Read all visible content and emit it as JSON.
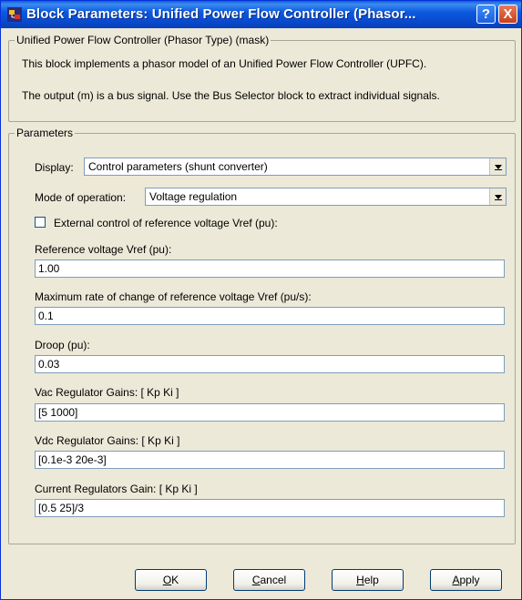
{
  "window": {
    "title": "Block Parameters: Unified Power Flow Controller (Phasor...",
    "help_glyph": "?",
    "close_glyph": "X"
  },
  "mask": {
    "legend": "Unified Power Flow Controller (Phasor Type) (mask)",
    "line1": "This block implements a phasor model of an Unified Power Flow Controller (UPFC).",
    "line2": "The output (m) is a bus signal. Use the Bus Selector block to extract individual signals."
  },
  "params": {
    "legend": "Parameters",
    "display_label": "Display:",
    "display_value": "Control parameters (shunt converter)",
    "mode_label": "Mode of operation:",
    "mode_value": "Voltage regulation",
    "external_label": "External control of reference voltage Vref (pu):",
    "external_checked": false,
    "fields": [
      {
        "label": "Reference voltage Vref (pu):",
        "value": "1.00"
      },
      {
        "label": "Maximum rate of change of reference voltage Vref (pu/s):",
        "value": "0.1"
      },
      {
        "label": "Droop (pu):",
        "value": "0.03"
      },
      {
        "label": "Vac Regulator Gains: [ Kp  Ki ]",
        "value": "[5 1000]"
      },
      {
        "label": "Vdc Regulator Gains: [ Kp  Ki ]",
        "value": "[0.1e-3 20e-3]"
      },
      {
        "label": "Current Regulators Gain: [ Kp Ki ]",
        "value": "[0.5 25]/3"
      }
    ]
  },
  "buttons": {
    "ok": {
      "mnemonic": "O",
      "rest": "K"
    },
    "cancel": {
      "mnemonic": "C",
      "rest": "ancel"
    },
    "help": {
      "mnemonic": "H",
      "rest": "elp"
    },
    "apply": {
      "mnemonic": "A",
      "rest": "pply"
    }
  },
  "colors": {
    "titlebar": "#0846c8",
    "dialog_bg": "#ece9d8",
    "close_button": "#c8401a"
  }
}
